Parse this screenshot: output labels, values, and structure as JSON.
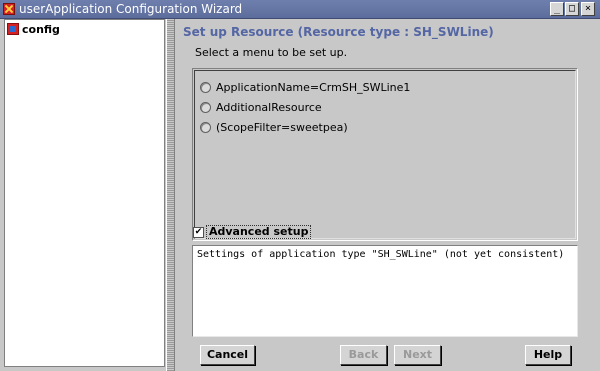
{
  "window": {
    "title": "userApplication Configuration Wizard",
    "controls": {
      "minimize": "_",
      "maximize": "□",
      "close": "×"
    }
  },
  "tree": {
    "items": [
      {
        "label": "config",
        "icon": "config-icon"
      }
    ]
  },
  "page": {
    "heading": "Set up Resource (Resource type : SH_SWLine)",
    "instruction": "Select a menu to be set up.",
    "options": [
      {
        "label": "ApplicationName=CrmSH_SWLine1",
        "selected": false
      },
      {
        "label": "AdditionalResource",
        "selected": false
      },
      {
        "label": "(ScopeFilter=sweetpea)",
        "selected": false
      }
    ],
    "advanced_setup": {
      "label": "Advanced setup",
      "checked": true,
      "check_glyph": "✔"
    },
    "message": "Settings of application type \"SH_SWLine\" (not yet consistent)"
  },
  "buttons": {
    "cancel": {
      "label": "Cancel",
      "enabled": true
    },
    "back": {
      "label": "Back",
      "enabled": false
    },
    "next": {
      "label": "Next",
      "enabled": false
    },
    "help": {
      "label": "Help",
      "enabled": true
    }
  },
  "colors": {
    "heading": "#5466a4",
    "titlebar": "#5c6c9c",
    "panel": "#c8c8c8"
  }
}
